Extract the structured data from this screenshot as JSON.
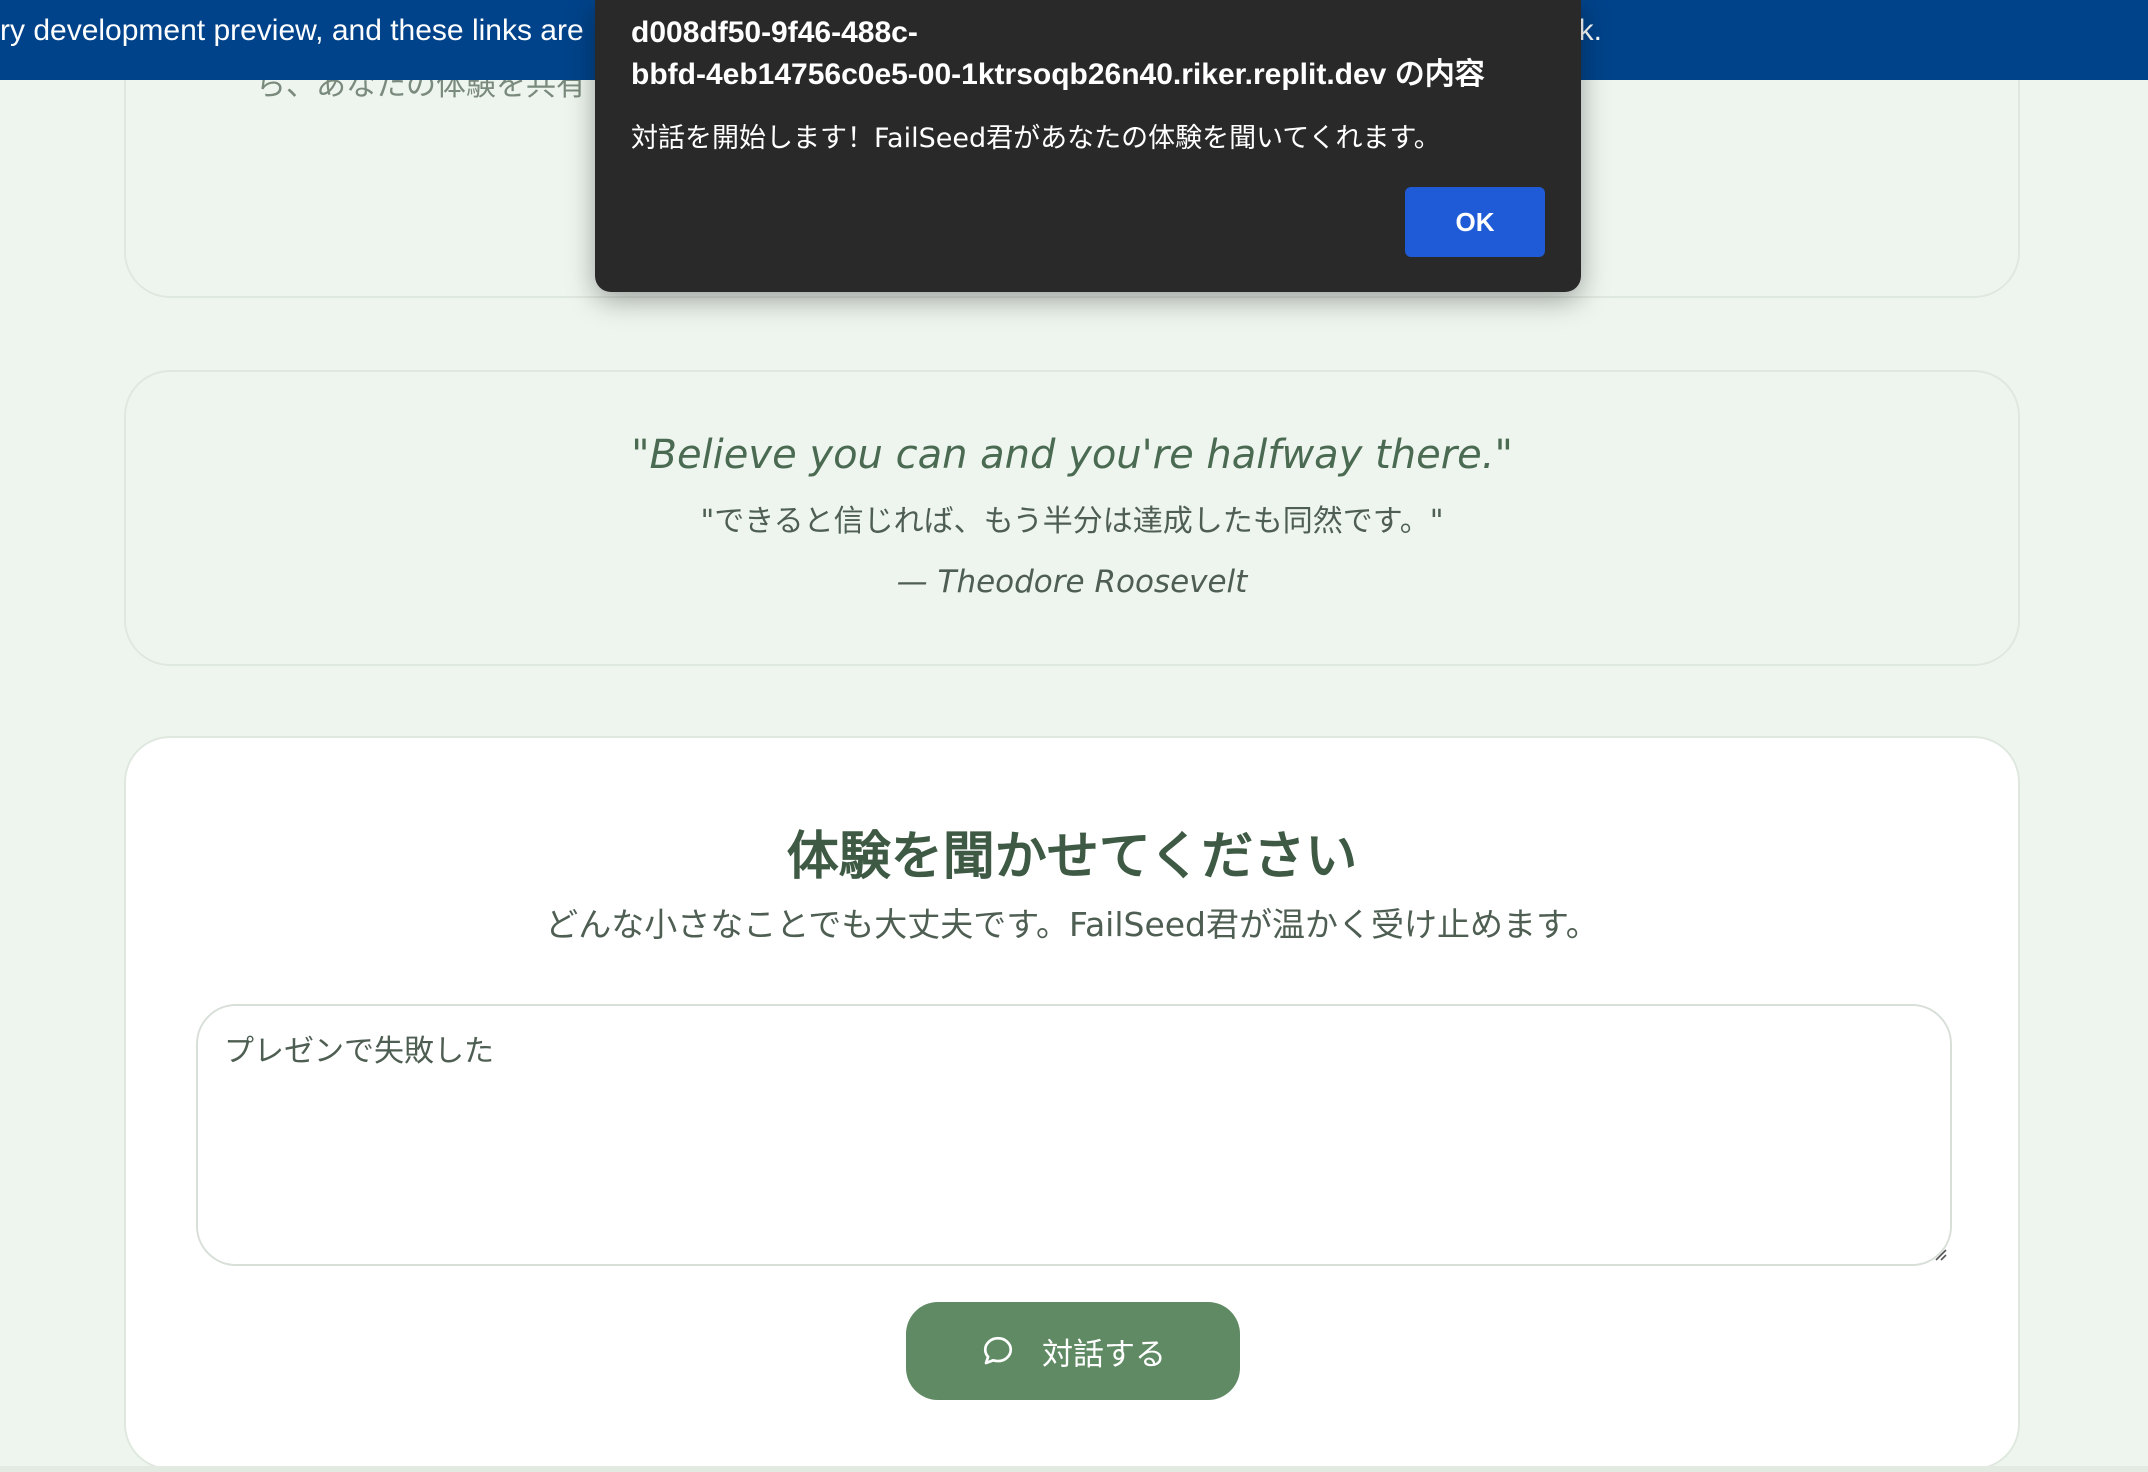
{
  "banner": {
    "text_left": "ry development preview, and these links are",
    "text_right": "nk."
  },
  "intro_card": {
    "partial_text": "ら、あなたの体験を共有                                                                                    可視化します"
  },
  "quote": {
    "english": "\"Believe you can and you're halfway there.\"",
    "japanese": "\"できると信じれば、もう半分は達成したも同然です。\"",
    "author": "— Theodore Roosevelt"
  },
  "form": {
    "title": "体験を聞かせてください",
    "subtitle": "どんな小さなことでも大丈夫です。FailSeed君が温かく受け止めます。",
    "textarea_value": "プレゼンで失敗した",
    "submit_label": "対話する",
    "submit_icon": "chat-bubble-icon"
  },
  "dialog": {
    "origin_line1": "d008df50-9f46-488c-",
    "origin_line2": "bbfd-4eb14756c0e5-00-1ktrsoqb26n40.riker.replit.dev の内容",
    "message": "対話を開始します！FailSeed君があなたの体験を聞いてくれます。",
    "ok_label": "OK"
  },
  "colors": {
    "page_bg": "#eef5ee",
    "banner_bg": "#00438a",
    "button_green": "#5f8a63",
    "dialog_bg": "#292929",
    "dialog_ok": "#1f5bd6",
    "heading_green": "#3e5a44"
  }
}
